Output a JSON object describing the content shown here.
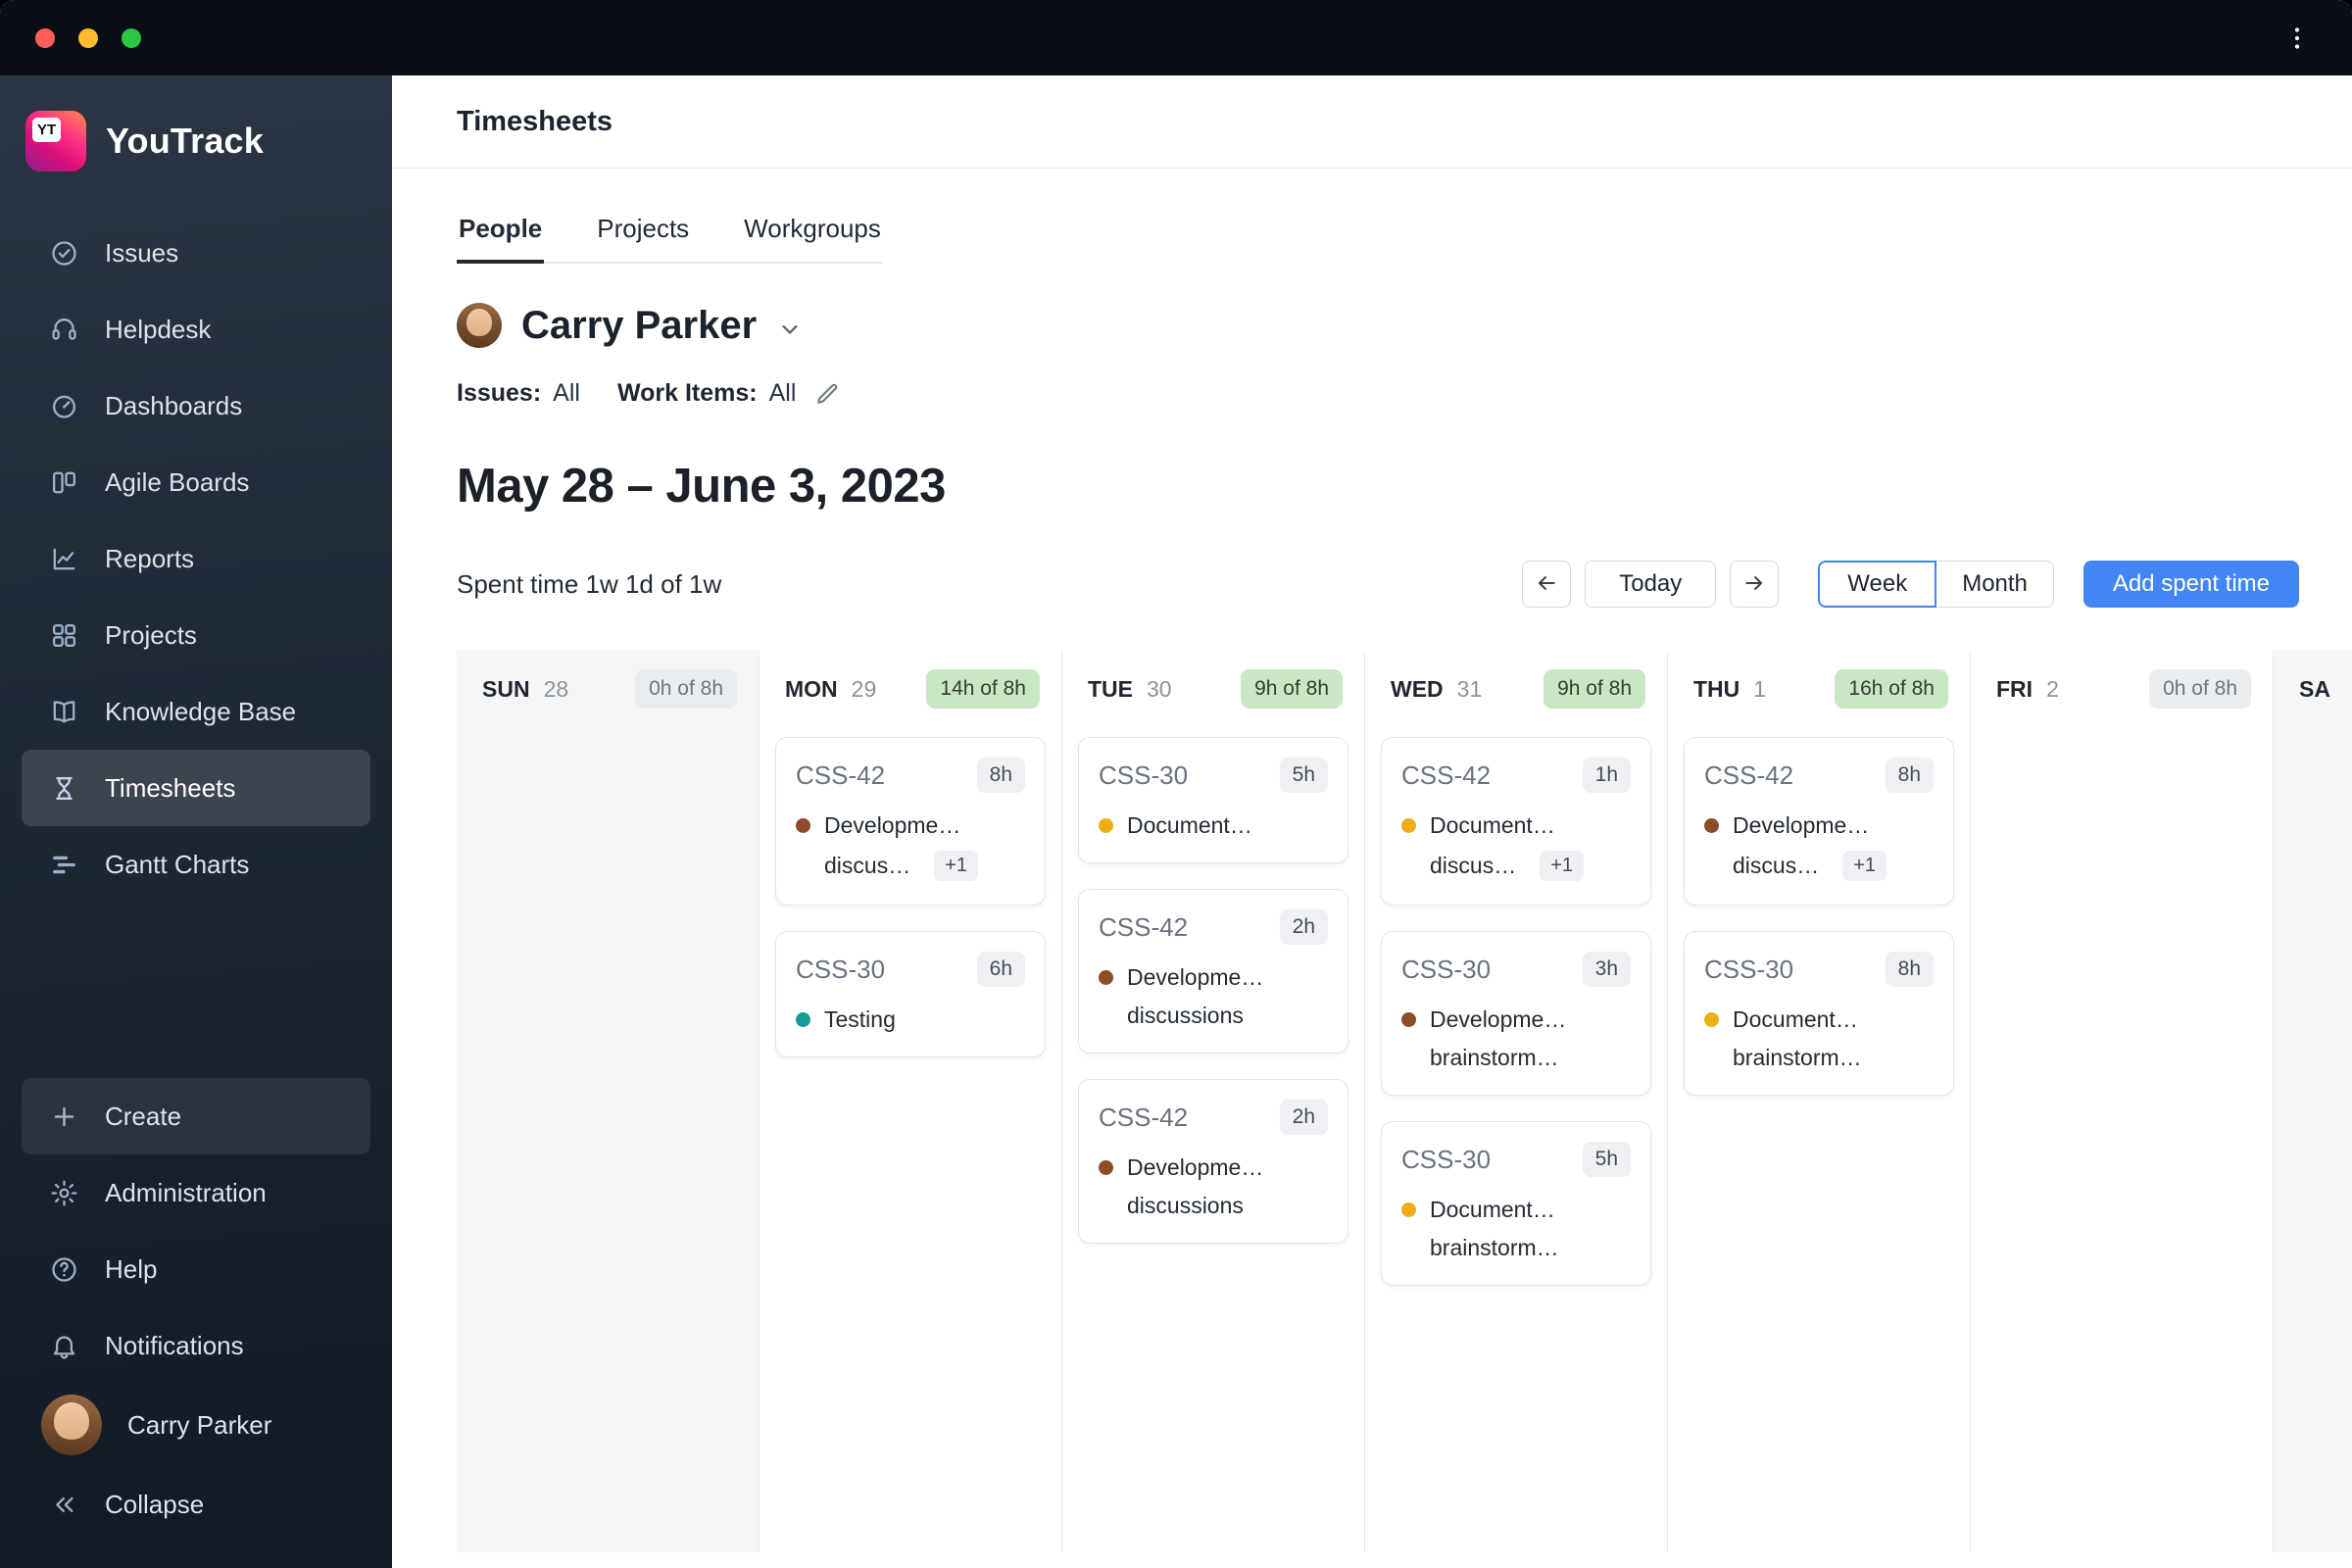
{
  "window": {
    "icons": [
      "close-button",
      "minimize-button",
      "zoom-button",
      "kebab-menu-icon"
    ]
  },
  "sidebar": {
    "brand": "YouTrack",
    "logo_badge": "YT",
    "items": [
      {
        "label": "Issues",
        "icon": "issues-icon"
      },
      {
        "label": "Helpdesk",
        "icon": "helpdesk-icon"
      },
      {
        "label": "Dashboards",
        "icon": "dashboards-icon"
      },
      {
        "label": "Agile Boards",
        "icon": "agile-boards-icon"
      },
      {
        "label": "Reports",
        "icon": "reports-icon"
      },
      {
        "label": "Projects",
        "icon": "projects-icon"
      },
      {
        "label": "Knowledge Base",
        "icon": "knowledge-base-icon"
      },
      {
        "label": "Timesheets",
        "icon": "timesheets-icon",
        "active": true
      },
      {
        "label": "Gantt Charts",
        "icon": "gantt-charts-icon"
      }
    ],
    "create_label": "Create",
    "bottom_items": [
      {
        "label": "Administration",
        "icon": "gear-icon"
      },
      {
        "label": "Help",
        "icon": "help-icon"
      },
      {
        "label": "Notifications",
        "icon": "bell-icon"
      }
    ],
    "user_name": "Carry Parker",
    "collapse_label": "Collapse"
  },
  "header": {
    "title": "Timesheets"
  },
  "tabs": [
    {
      "label": "People",
      "active": true
    },
    {
      "label": "Projects"
    },
    {
      "label": "Workgroups"
    }
  ],
  "person": {
    "name": "Carry Parker"
  },
  "filters": {
    "issues_label": "Issues:",
    "issues_value": "All",
    "work_items_label": "Work Items:",
    "work_items_value": "All"
  },
  "period": {
    "title": "May 28 – June 3, 2023",
    "spent_time": "Spent time 1w 1d of 1w"
  },
  "controls": {
    "today_label": "Today",
    "week_label": "Week",
    "month_label": "Month",
    "add_label": "Add spent time"
  },
  "calendar": {
    "days": [
      {
        "abbrev": "SUN",
        "date": "28",
        "badge": "0h of 8h",
        "badge_type": "gray",
        "weekend": true,
        "cards": []
      },
      {
        "abbrev": "MON",
        "date": "29",
        "badge": "14h of 8h",
        "badge_type": "green",
        "weekend": false,
        "cards": [
          {
            "issue": "CSS-42",
            "hours": "8h",
            "dot": "brown",
            "line1": "Developme…",
            "line2": "discus…",
            "plus": "+1"
          },
          {
            "issue": "CSS-30",
            "hours": "6h",
            "dot": "teal",
            "line1": "Testing"
          }
        ]
      },
      {
        "abbrev": "TUE",
        "date": "30",
        "badge": "9h of 8h",
        "badge_type": "green",
        "weekend": false,
        "cards": [
          {
            "issue": "CSS-30",
            "hours": "5h",
            "dot": "yellow",
            "line1": "Document…"
          },
          {
            "issue": "CSS-42",
            "hours": "2h",
            "dot": "brown",
            "line1": "Developme…",
            "line2": "discussions"
          },
          {
            "issue": "CSS-42",
            "hours": "2h",
            "dot": "brown",
            "line1": "Developme…",
            "line2": "discussions"
          }
        ]
      },
      {
        "abbrev": "WED",
        "date": "31",
        "badge": "9h of 8h",
        "badge_type": "green",
        "weekend": false,
        "cards": [
          {
            "issue": "CSS-42",
            "hours": "1h",
            "dot": "yellow",
            "line1": "Document…",
            "line2": "discus…",
            "plus": "+1"
          },
          {
            "issue": "CSS-30",
            "hours": "3h",
            "dot": "brown",
            "line1": "Developme…",
            "line2": "brainstorm…"
          },
          {
            "issue": "CSS-30",
            "hours": "5h",
            "dot": "yellow",
            "line1": "Document…",
            "line2": "brainstorm…"
          }
        ]
      },
      {
        "abbrev": "THU",
        "date": "1",
        "badge": "16h of 8h",
        "badge_type": "green",
        "weekend": false,
        "cards": [
          {
            "issue": "CSS-42",
            "hours": "8h",
            "dot": "brown",
            "line1": "Developme…",
            "line2": "discus…",
            "plus": "+1"
          },
          {
            "issue": "CSS-30",
            "hours": "8h",
            "dot": "yellow",
            "line1": "Document…",
            "line2": "brainstorm…"
          }
        ]
      },
      {
        "abbrev": "FRI",
        "date": "2",
        "badge": "0h of 8h",
        "badge_type": "gray",
        "weekend": false,
        "cards": []
      },
      {
        "abbrev": "SA",
        "date": "",
        "badge": "",
        "badge_type": "gray",
        "weekend": true,
        "cards": []
      }
    ]
  },
  "colors": {
    "accent_blue": "#4285f4",
    "brand_pink": "#fb2f84",
    "badge_green_bg": "#c9e7c4",
    "badge_gray_bg": "#eaedf0",
    "dot_brown": "#8e4b28",
    "dot_yellow": "#eeae13",
    "dot_teal": "#179a94"
  }
}
